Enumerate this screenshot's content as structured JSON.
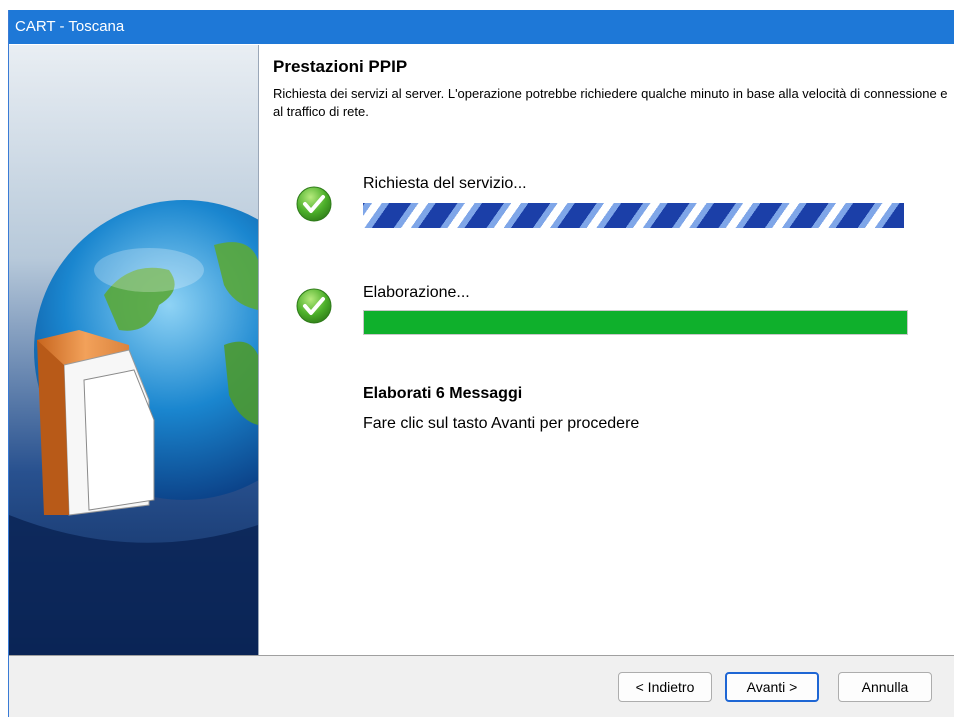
{
  "window": {
    "title": "CART - Toscana"
  },
  "page": {
    "title": "Prestazioni PPIP",
    "description": "Richiesta dei servizi al server. L'operazione potrebbe richiedere qualche minuto in base alla velocità di connessione e al traffico di rete."
  },
  "steps": [
    {
      "label": "Richiesta del servizio...",
      "status_icon": "check-icon",
      "progress_style": "marquee"
    },
    {
      "label": "Elaborazione...",
      "status_icon": "check-icon",
      "progress": 1.0,
      "progress_style": "solid"
    }
  ],
  "result": {
    "title": "Elaborati 6 Messaggi",
    "message": "Fare clic sul tasto Avanti per procedere"
  },
  "buttons": {
    "back": "< Indietro",
    "next": "Avanti >",
    "cancel": "Annulla"
  },
  "colors": {
    "titlebar": "#1e78d7",
    "progress_green": "#0fb02c",
    "marquee_blue": "#1b3fa8",
    "check_green": "#4caf2a"
  }
}
